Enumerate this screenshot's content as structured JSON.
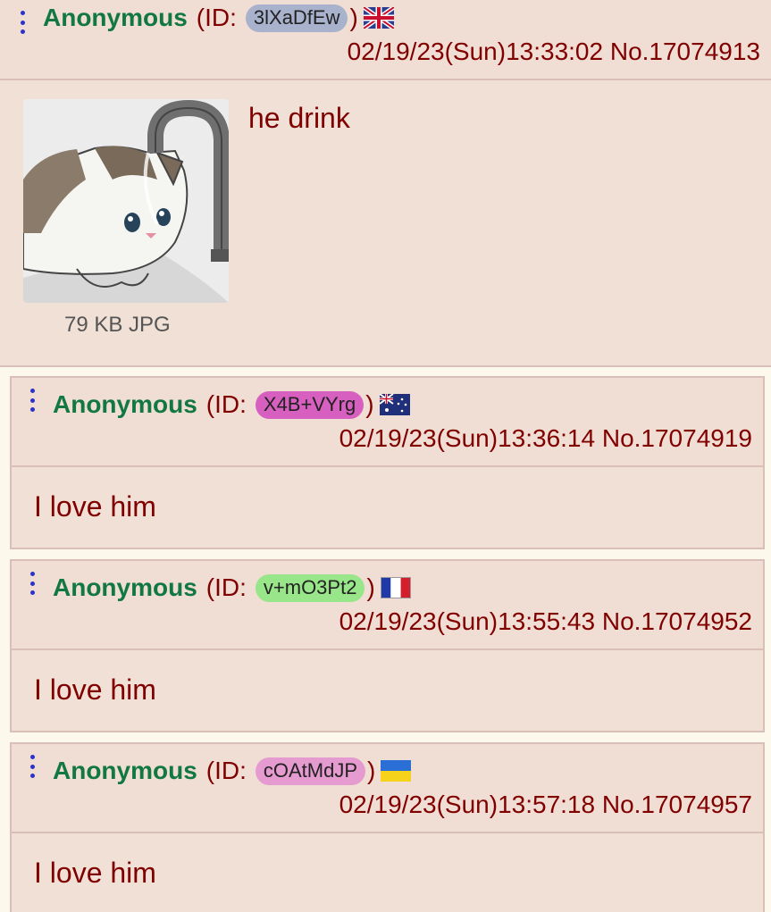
{
  "posts": [
    {
      "name": "Anonymous",
      "id_prefix": "(ID:",
      "id": "3lXaDfEw",
      "id_suffix": ")",
      "id_color": "#a8b2cc",
      "flag": "uk-flag-icon",
      "date": "02/19/23(Sun)13:33:02",
      "number": "No.17074913",
      "text": "he drink",
      "file_info": "79 KB JPG"
    },
    {
      "name": "Anonymous",
      "id_prefix": "(ID:",
      "id": "X4B+VYrg",
      "id_suffix": ")",
      "id_color": "#d65fbf",
      "flag": "australia-flag-icon",
      "date": "02/19/23(Sun)13:36:14",
      "number": "No.17074919",
      "text": "I love him"
    },
    {
      "name": "Anonymous",
      "id_prefix": "(ID:",
      "id": "v+mO3Pt2",
      "id_suffix": ")",
      "id_color": "#98e58a",
      "flag": "france-flag-icon",
      "date": "02/19/23(Sun)13:55:43",
      "number": "No.17074952",
      "text": "I love him"
    },
    {
      "name": "Anonymous",
      "id_prefix": "(ID:",
      "id": "cOAtMdJP",
      "id_suffix": ")",
      "id_color": "#e59ad0",
      "flag": "ukraine-flag-icon",
      "date": "02/19/23(Sun)13:57:18",
      "number": "No.17074957",
      "text": "I love him"
    }
  ]
}
